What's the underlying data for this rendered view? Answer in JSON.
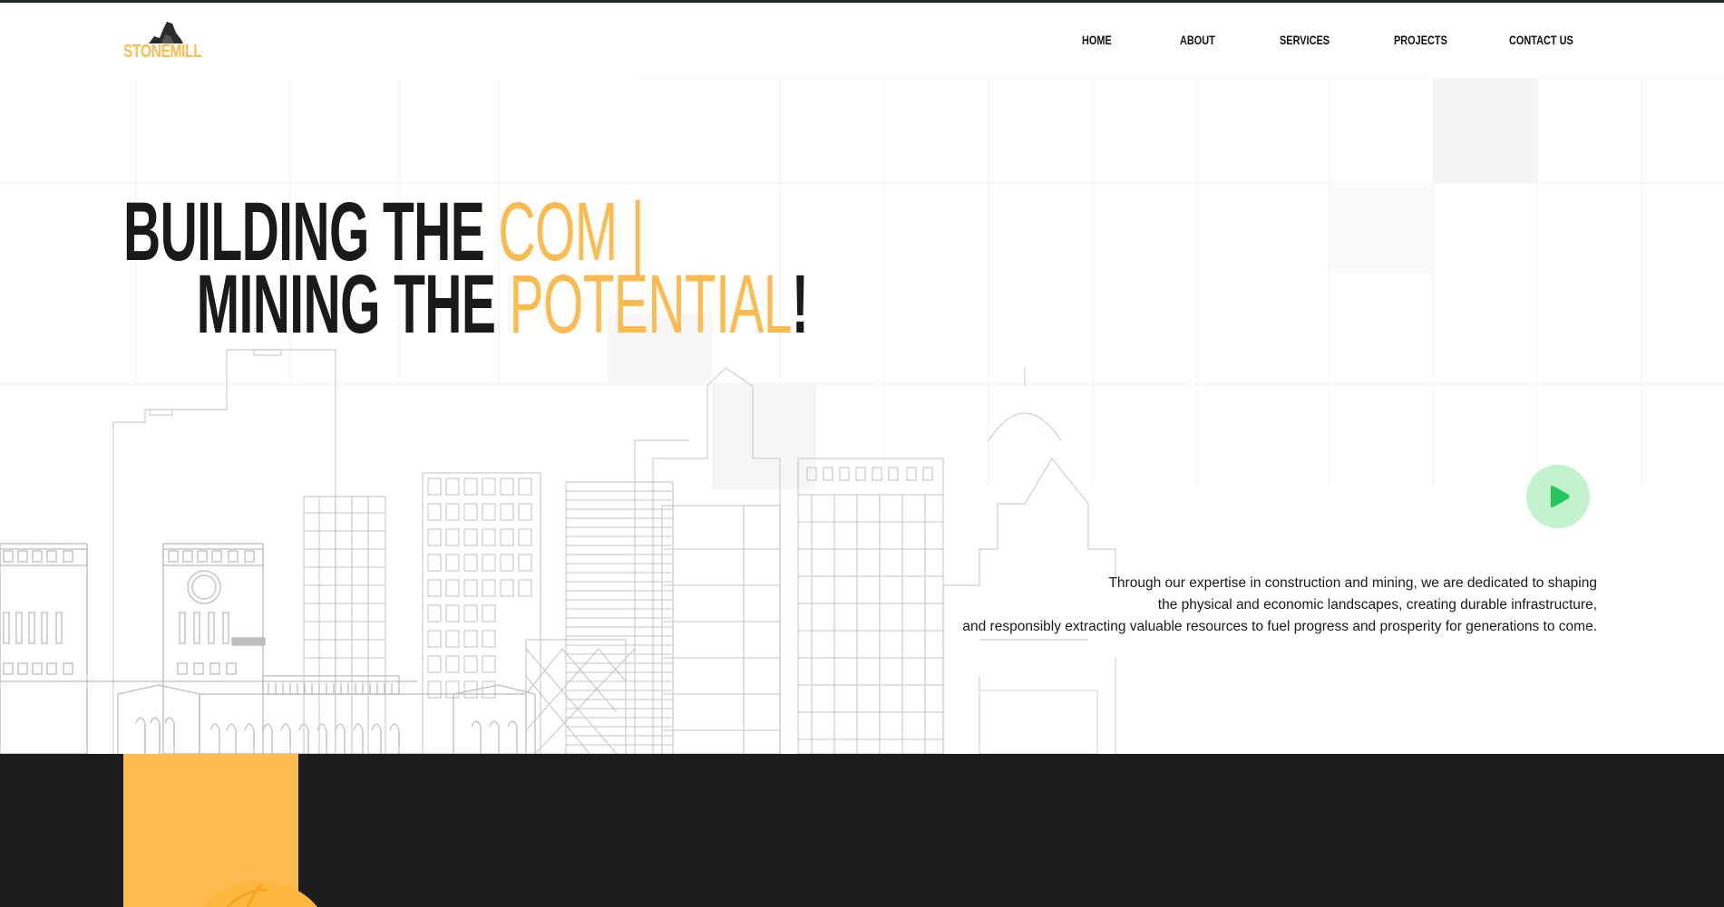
{
  "brand": {
    "name": "STONEMILL",
    "colors": {
      "accent": "#fdbb4f",
      "dark": "#1c1d1f",
      "play": "#22c55e",
      "play_bg": "#c4f2cd"
    }
  },
  "nav": {
    "items": [
      {
        "label": "HOME"
      },
      {
        "label": "ABOUT"
      },
      {
        "label": "SERVICES"
      },
      {
        "label": "PROJECTS"
      },
      {
        "label": "CONTACT US"
      }
    ]
  },
  "hero": {
    "headline_line1_prefix": "BUILDING THE ",
    "headline_line1_accent": "COM |",
    "headline_line2_prefix": "MINING THE ",
    "headline_line2_accent": "POTENTIAL",
    "headline_line2_suffix": "!",
    "description": [
      "Through our expertise in construction and mining, we are dedicated to shaping",
      "the physical and economic landscapes, creating durable infrastructure,",
      "and responsibly extracting valuable resources to fuel progress and prosperity for generations to come."
    ],
    "play_icon": "play-icon"
  }
}
